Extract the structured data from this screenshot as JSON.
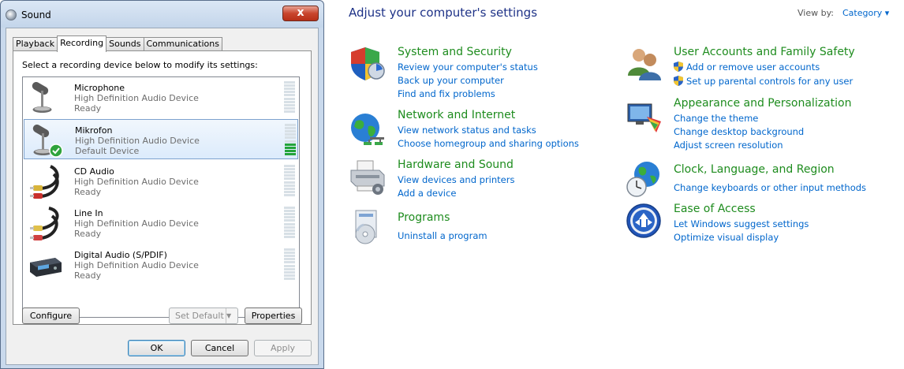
{
  "sound": {
    "title": "Sound",
    "close_glyph": "x",
    "tabs": [
      "Playback",
      "Recording",
      "Sounds",
      "Communications"
    ],
    "active_tab": "Recording",
    "instruction": "Select a recording device below to modify its settings:",
    "devices": [
      {
        "name": "Microphone",
        "desc": "High Definition Audio Device",
        "status": "Ready",
        "icon": "microphone-icon",
        "level": 0
      },
      {
        "name": "Mikrofon",
        "desc": "High Definition Audio Device",
        "status": "Default Device",
        "icon": "microphone-default-icon",
        "level": 0.4
      },
      {
        "name": "CD Audio",
        "desc": "High Definition Audio Device",
        "status": "Ready",
        "icon": "rca-cable-icon",
        "level": 0
      },
      {
        "name": "Line In",
        "desc": "High Definition Audio Device",
        "status": "Ready",
        "icon": "line-in-cable-icon",
        "level": 0
      },
      {
        "name": "Digital Audio (S/PDIF)",
        "desc": "High Definition Audio Device",
        "status": "Ready",
        "icon": "digital-audio-icon",
        "level": 0
      }
    ],
    "buttons": {
      "configure": "Configure",
      "set_default": "Set Default",
      "properties": "Properties",
      "ok": "OK",
      "cancel": "Cancel",
      "apply": "Apply"
    },
    "meter_on_color": "#23a43a"
  },
  "control_panel": {
    "heading": "Adjust your computer's settings",
    "view_by_label": "View by:",
    "view_by_value": "Category ▾",
    "title_color": "#1e8c1e",
    "link_color": "#0066cc",
    "categories": {
      "system": {
        "title": "System and Security",
        "icon": "shield-system-icon",
        "links": [
          "Review your computer's status",
          "Back up your computer",
          "Find and fix problems"
        ]
      },
      "network": {
        "title": "Network and Internet",
        "icon": "globe-network-icon",
        "links": [
          "View network status and tasks",
          "Choose homegroup and sharing options"
        ]
      },
      "hardware": {
        "title": "Hardware and Sound",
        "icon": "printer-icon",
        "links": [
          "View devices and printers",
          "Add a device"
        ]
      },
      "programs": {
        "title": "Programs",
        "icon": "programs-icon",
        "links": [
          "Uninstall a program"
        ]
      },
      "users": {
        "title": "User Accounts and Family Safety",
        "icon": "users-icon",
        "links": [
          "Add or remove user accounts",
          "Set up parental controls for any user"
        ]
      },
      "appearance": {
        "title": "Appearance and Personalization",
        "icon": "appearance-icon",
        "links": [
          "Change the theme",
          "Change desktop background",
          "Adjust screen resolution"
        ]
      },
      "clock": {
        "title": "Clock, Language, and Region",
        "icon": "clock-globe-icon",
        "links": [
          "Change keyboards or other input methods"
        ]
      },
      "ease": {
        "title": "Ease of Access",
        "icon": "ease-of-access-icon",
        "links": [
          "Let Windows suggest settings",
          "Optimize visual display"
        ]
      }
    }
  }
}
